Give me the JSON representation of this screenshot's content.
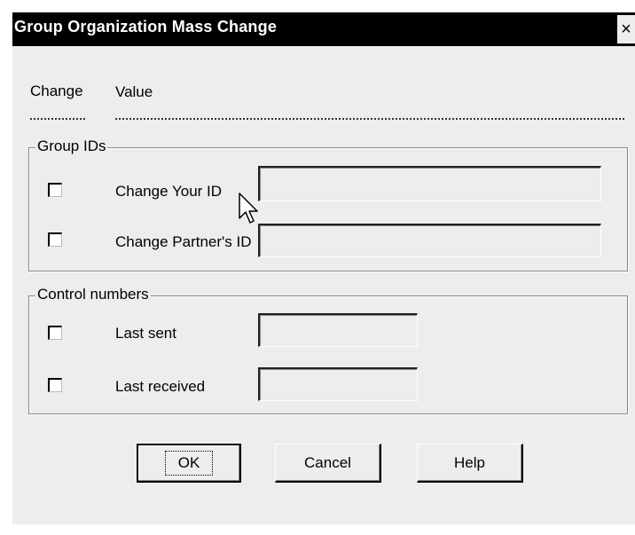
{
  "dialog": {
    "title": "Group Organization Mass Change",
    "close_glyph": "×"
  },
  "headers": {
    "change": "Change",
    "value": "Value"
  },
  "group_ids": {
    "legend": "Group IDs",
    "rows": [
      {
        "label": "Change Your ID",
        "checked": false,
        "value": ""
      },
      {
        "label": "Change Partner's ID",
        "checked": false,
        "value": ""
      }
    ]
  },
  "control_numbers": {
    "legend": "Control numbers",
    "rows": [
      {
        "label": "Last sent",
        "checked": false,
        "value": ""
      },
      {
        "label": "Last received",
        "checked": false,
        "value": ""
      }
    ]
  },
  "buttons": {
    "ok": "OK",
    "cancel": "Cancel",
    "help": "Help"
  },
  "cursor": "arrow-pointer-icon"
}
